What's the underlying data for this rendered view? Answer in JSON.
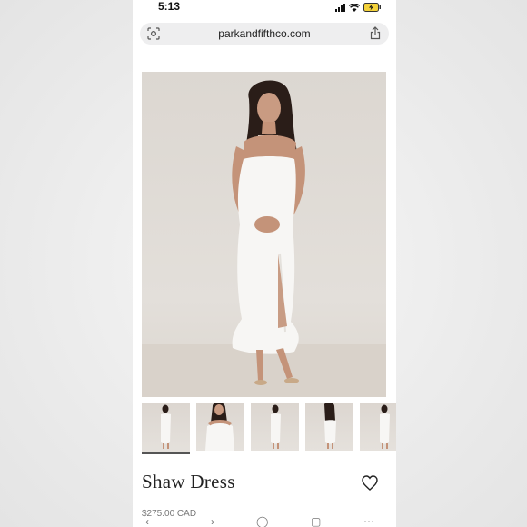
{
  "status_bar": {
    "time": "5:13"
  },
  "browser": {
    "url": "parkandfifthco.com"
  },
  "product": {
    "title": "Shaw Dress",
    "price": "$275.00 CAD"
  },
  "gallery": {
    "thumbnail_count": 5,
    "active_index": 0
  },
  "colors": {
    "background": "#ebebeb",
    "url_bar": "#eeeeef",
    "hero_backdrop": "#dcd7d1",
    "text": "#222222"
  }
}
